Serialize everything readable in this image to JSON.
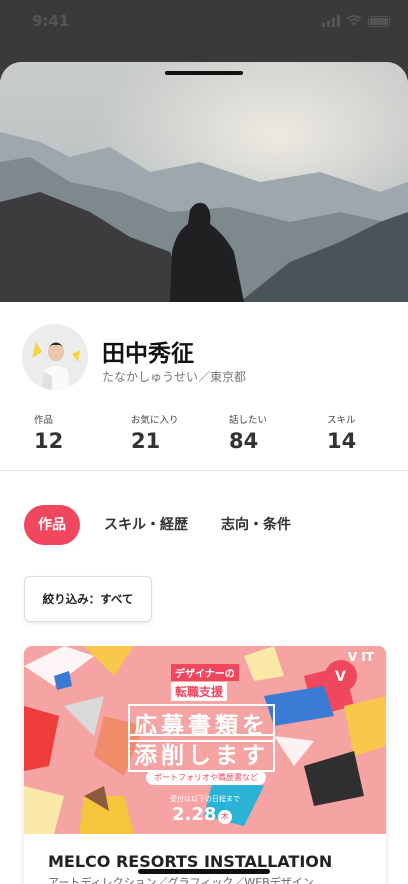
{
  "status_bar": {
    "time": "9:41"
  },
  "profile": {
    "name": "田中秀征",
    "kana_location": "たなかしゅうせい／東京都"
  },
  "stats": [
    {
      "label": "作品",
      "value": "12"
    },
    {
      "label": "お気に入り",
      "value": "21"
    },
    {
      "label": "話したい",
      "value": "84"
    },
    {
      "label": "スキル",
      "value": "14"
    }
  ],
  "tabs": [
    {
      "label": "作品",
      "active": true
    },
    {
      "label": "スキル・経歴",
      "active": false
    },
    {
      "label": "志向・条件",
      "active": false
    }
  ],
  "filter": {
    "label": "絞り込み：すべて"
  },
  "card": {
    "banner": {
      "sub_line1": "デザイナーの",
      "sub_line2": "転職支援",
      "big_line1": "応募書類を",
      "big_line2": "添削します",
      "note": "ポートフォリオや職歴書など",
      "deadline_label": "受付は以下の日程まで",
      "date": "2.28",
      "weekday": "木",
      "brand": "V     IT"
    },
    "title": "MELCO RESORTS INSTALLATION",
    "subtitle": "アートディレクション／グラフィック／WEBデザイン"
  },
  "colors": {
    "accent": "#f0475e",
    "banner_bg": "#f6a3a3"
  }
}
